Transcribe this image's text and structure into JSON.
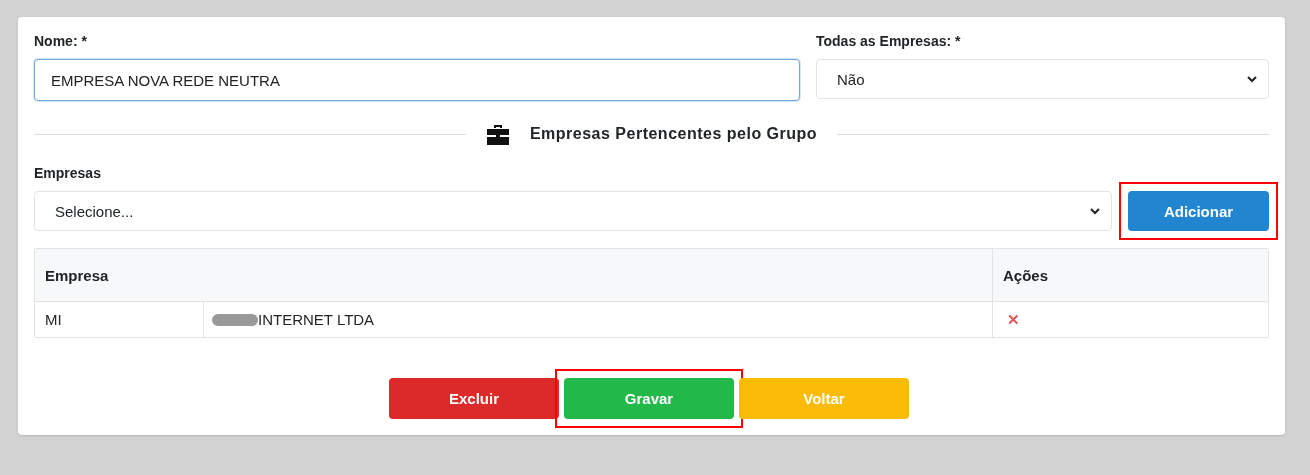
{
  "form": {
    "name_field": {
      "label": "Nome: *",
      "value": "EMPRESA NOVA REDE NEUTRA"
    },
    "all_companies": {
      "label": "Todas as Empresas: *",
      "value": "Não"
    }
  },
  "section": {
    "title": "Empresas Pertencentes pelo Grupo"
  },
  "companies_select": {
    "label": "Empresas",
    "placeholder": "Selecione...",
    "button": {
      "label": "Adicionar",
      "highlighted": true
    }
  },
  "table": {
    "columns": [
      "Empresa",
      "Ações"
    ],
    "rows": [
      {
        "code": "MI",
        "name": "INTERNET LTDA",
        "redacted": true,
        "remove": "✕"
      }
    ]
  },
  "actions": [
    {
      "kind": "danger",
      "label": "Excluir",
      "highlighted": false
    },
    {
      "kind": "success",
      "label": "Gravar",
      "highlighted": true
    },
    {
      "kind": "warning",
      "label": "Voltar",
      "highlighted": false
    }
  ]
}
